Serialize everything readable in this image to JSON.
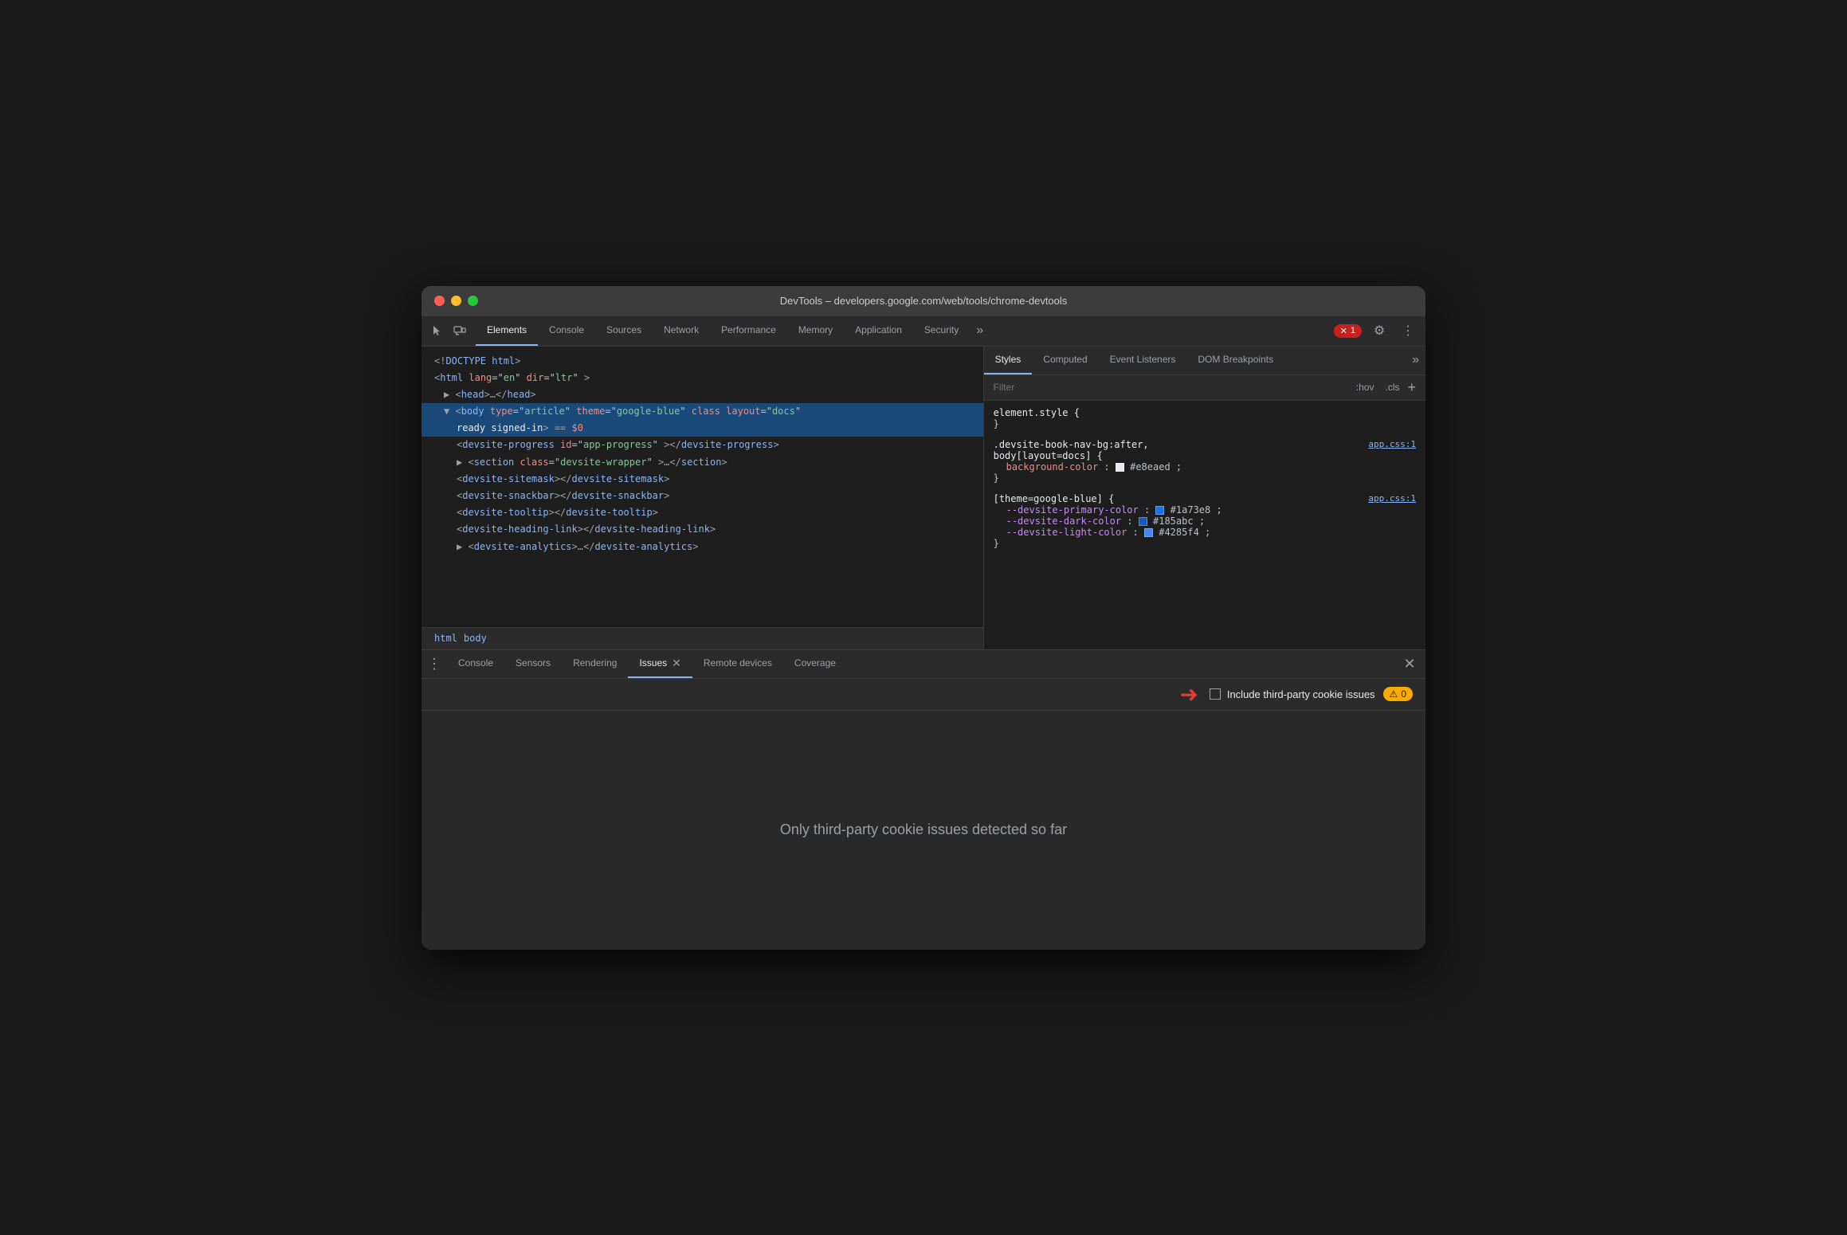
{
  "window": {
    "title": "DevTools – developers.google.com/web/tools/chrome-devtools"
  },
  "toolbar": {
    "tabs": [
      {
        "label": "Elements",
        "active": true
      },
      {
        "label": "Console",
        "active": false
      },
      {
        "label": "Sources",
        "active": false
      },
      {
        "label": "Network",
        "active": false
      },
      {
        "label": "Performance",
        "active": false
      },
      {
        "label": "Memory",
        "active": false
      },
      {
        "label": "Application",
        "active": false
      },
      {
        "label": "Security",
        "active": false
      }
    ],
    "more_label": "»",
    "error_count": "1",
    "settings_icon": "⚙",
    "more_icon": "⋮"
  },
  "styles_panel": {
    "tabs": [
      {
        "label": "Styles",
        "active": true
      },
      {
        "label": "Computed",
        "active": false
      },
      {
        "label": "Event Listeners",
        "active": false
      },
      {
        "label": "DOM Breakpoints",
        "active": false
      }
    ],
    "more_label": "»",
    "filter_placeholder": "Filter",
    "filter_hov": ":hov",
    "filter_cls": ".cls",
    "filter_add": "+",
    "rules": [
      {
        "selector": "element.style {",
        "close": "}",
        "source": "",
        "properties": []
      },
      {
        "selector": ".devsite-book-nav-bg:after,",
        "selector2": "body[layout=docs] {",
        "source": "app.css:1",
        "close": "}",
        "properties": [
          {
            "name": "background-color:",
            "value": "#e8eaed",
            "color": "#e8eaed",
            "has_swatch": true
          }
        ]
      },
      {
        "selector": "[theme=google-blue] {",
        "source": "app.css:1",
        "close": "}",
        "properties": [
          {
            "name": "--devsite-primary-color:",
            "value": "#1a73e8",
            "color": "#1a73e8",
            "has_swatch": true
          },
          {
            "name": "--devsite-dark-color:",
            "value": "#185abc",
            "color": "#185abc",
            "has_swatch": true
          },
          {
            "name": "--devsite-light-color:",
            "value": "#4285f4",
            "color": "#4285f4",
            "has_swatch": true
          }
        ]
      }
    ]
  },
  "dom": {
    "lines": [
      {
        "indent": 0,
        "text": "<!DOCTYPE html>",
        "type": "doctype"
      },
      {
        "indent": 0,
        "text": "<html lang=\"en\" dir=\"ltr\">",
        "type": "tag"
      },
      {
        "indent": 1,
        "text": "▶ <head>…</head>",
        "type": "collapsed"
      },
      {
        "indent": 1,
        "text": "<body type=\"article\" theme=\"google-blue\" class layout=\"docs\"",
        "type": "body-selected"
      },
      {
        "indent": 2,
        "text": "ready signed-in> == $0",
        "type": "body-eq"
      },
      {
        "indent": 2,
        "text": "<devsite-progress id=\"app-progress\"></devsite-progress>",
        "type": "element"
      },
      {
        "indent": 2,
        "text": "▶ <section class=\"devsite-wrapper\">…</section>",
        "type": "collapsed"
      },
      {
        "indent": 2,
        "text": "<devsite-sitemask></devsite-sitemask>",
        "type": "element"
      },
      {
        "indent": 2,
        "text": "<devsite-snackbar></devsite-snackbar>",
        "type": "element"
      },
      {
        "indent": 2,
        "text": "<devsite-tooltip></devsite-tooltip>",
        "type": "element"
      },
      {
        "indent": 2,
        "text": "<devsite-heading-link></devsite-heading-link>",
        "type": "element"
      },
      {
        "indent": 2,
        "text": "▶ <devsite-analytics>…</devsite-analytics>",
        "type": "collapsed-analytics"
      }
    ]
  },
  "breadcrumb": {
    "items": [
      "html",
      "body"
    ]
  },
  "drawer": {
    "tabs": [
      {
        "label": "Console",
        "active": false,
        "closeable": false
      },
      {
        "label": "Sensors",
        "active": false,
        "closeable": false
      },
      {
        "label": "Rendering",
        "active": false,
        "closeable": false
      },
      {
        "label": "Issues",
        "active": true,
        "closeable": true
      },
      {
        "label": "Remote devices",
        "active": false,
        "closeable": false
      },
      {
        "label": "Coverage",
        "active": false,
        "closeable": false
      }
    ]
  },
  "issues": {
    "checkbox_label": "Include third-party cookie issues",
    "warning_count": "0",
    "empty_message": "Only third-party cookie issues detected so far"
  }
}
